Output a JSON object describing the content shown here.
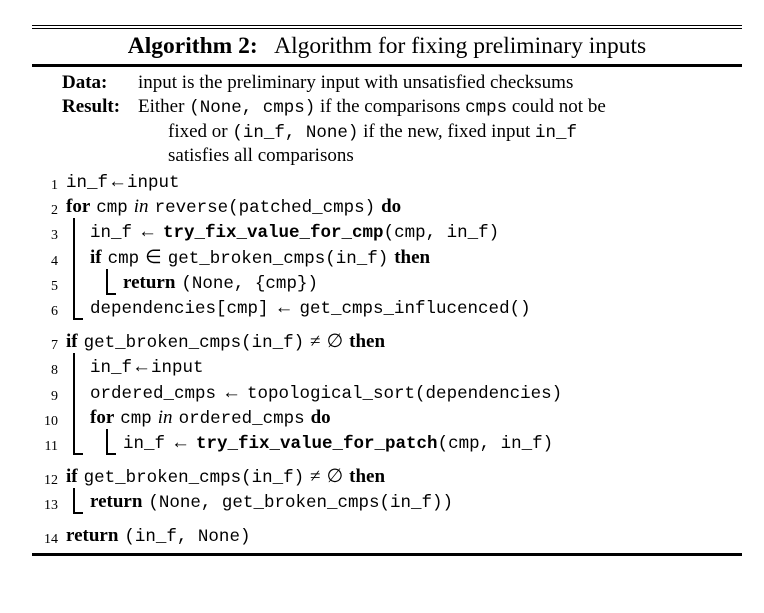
{
  "caption": {
    "label": "Algorithm 2:",
    "text": "Algorithm for fixing preliminary inputs"
  },
  "io": {
    "data_key": "Data:",
    "data_value": "input is the preliminary input with unsatisfied checksums",
    "result_key": "Result:",
    "result_line1_a": "Either ",
    "result_line1_mono1": "(None, cmps)",
    "result_line1_b": " if the comparisons ",
    "result_line1_mono2": "cmps",
    "result_line1_c": " could not be",
    "result_line2_a": "fixed or ",
    "result_line2_mono1": "(in_f, None)",
    "result_line2_b": " if the new, fixed input ",
    "result_line2_mono2": "in_f",
    "result_line3": "satisfies all comparisons"
  },
  "lines": [
    {
      "no": "1",
      "text": "in_f←input",
      "tokens": [
        {
          "t": "in_f",
          "s": "mono"
        },
        {
          "t": "←",
          "s": "sym"
        },
        {
          "t": "input",
          "s": "mono"
        }
      ]
    },
    {
      "no": "2",
      "text": "for cmp in reverse(patched_cmps) do",
      "tokens": [
        {
          "t": "for",
          "s": "kw"
        },
        {
          "t": " ",
          "s": "sp"
        },
        {
          "t": "cmp",
          "s": "mono"
        },
        {
          "t": " ",
          "s": "sp"
        },
        {
          "t": "in",
          "s": "it"
        },
        {
          "t": " ",
          "s": "sp"
        },
        {
          "t": "reverse(patched_cmps)",
          "s": "mono"
        },
        {
          "t": " ",
          "s": "sp"
        },
        {
          "t": "do",
          "s": "kw"
        }
      ]
    },
    {
      "no": "3",
      "text": "in_f ← try_fix_value_for_cmp(cmp, in_f)",
      "tokens": [
        {
          "t": "in_f",
          "s": "mono"
        },
        {
          "t": " ",
          "s": "sp"
        },
        {
          "t": "←",
          "s": "sym"
        },
        {
          "t": " ",
          "s": "sp"
        },
        {
          "t": "try_fix_value_for_cmp",
          "s": "monob"
        },
        {
          "t": "(cmp, in_f)",
          "s": "mono"
        }
      ]
    },
    {
      "no": "4",
      "text": "if cmp ∈ get_broken_cmps(in_f) then",
      "tokens": [
        {
          "t": "if",
          "s": "kw"
        },
        {
          "t": " ",
          "s": "sp"
        },
        {
          "t": "cmp",
          "s": "mono"
        },
        {
          "t": " ",
          "s": "sp"
        },
        {
          "t": "∈",
          "s": "sym"
        },
        {
          "t": " ",
          "s": "sp"
        },
        {
          "t": "get_broken_cmps(in_f)",
          "s": "mono"
        },
        {
          "t": " ",
          "s": "sp"
        },
        {
          "t": "then",
          "s": "kw"
        }
      ]
    },
    {
      "no": "5",
      "text": "return (None, {cmp})",
      "tokens": [
        {
          "t": "return",
          "s": "kw"
        },
        {
          "t": " ",
          "s": "sp"
        },
        {
          "t": "(None, {cmp})",
          "s": "mono"
        }
      ]
    },
    {
      "no": "6",
      "text": "dependencies[cmp] ← get_cmps_influcenced()",
      "tokens": [
        {
          "t": "dependencies[cmp]",
          "s": "mono"
        },
        {
          "t": " ",
          "s": "sp"
        },
        {
          "t": "←",
          "s": "sym"
        },
        {
          "t": " ",
          "s": "sp"
        },
        {
          "t": "get_cmps_influcenced()",
          "s": "mono"
        }
      ]
    },
    {
      "no": "7",
      "text": "if get_broken_cmps(in_f) ≠ ∅ then",
      "tokens": [
        {
          "t": "if",
          "s": "kw"
        },
        {
          "t": " ",
          "s": "sp"
        },
        {
          "t": "get_broken_cmps(in_f)",
          "s": "mono"
        },
        {
          "t": " ",
          "s": "sp"
        },
        {
          "t": "≠",
          "s": "sym"
        },
        {
          "t": " ",
          "s": "sp"
        },
        {
          "t": "∅",
          "s": "sym"
        },
        {
          "t": " ",
          "s": "sp"
        },
        {
          "t": "then",
          "s": "kw"
        }
      ]
    },
    {
      "no": "8",
      "text": "in_f←input",
      "tokens": [
        {
          "t": "in_f",
          "s": "mono"
        },
        {
          "t": "←",
          "s": "sym"
        },
        {
          "t": "input",
          "s": "mono"
        }
      ]
    },
    {
      "no": "9",
      "text": "ordered_cmps ← topological_sort(dependencies)",
      "tokens": [
        {
          "t": "ordered_cmps",
          "s": "mono"
        },
        {
          "t": " ",
          "s": "sp"
        },
        {
          "t": "←",
          "s": "sym"
        },
        {
          "t": " ",
          "s": "sp"
        },
        {
          "t": "topological_sort(dependencies)",
          "s": "mono"
        }
      ]
    },
    {
      "no": "10",
      "text": "for cmp in ordered_cmps do",
      "tokens": [
        {
          "t": "for",
          "s": "kw"
        },
        {
          "t": " ",
          "s": "sp"
        },
        {
          "t": "cmp",
          "s": "mono"
        },
        {
          "t": " ",
          "s": "sp"
        },
        {
          "t": "in",
          "s": "it"
        },
        {
          "t": " ",
          "s": "sp"
        },
        {
          "t": "ordered_cmps",
          "s": "mono"
        },
        {
          "t": " ",
          "s": "sp"
        },
        {
          "t": "do",
          "s": "kw"
        }
      ]
    },
    {
      "no": "11",
      "text": "in_f ← try_fix_value_for_patch(cmp, in_f)",
      "tokens": [
        {
          "t": "in_f",
          "s": "mono"
        },
        {
          "t": " ",
          "s": "sp"
        },
        {
          "t": "←",
          "s": "sym"
        },
        {
          "t": " ",
          "s": "sp"
        },
        {
          "t": "try_fix_value_for_patch",
          "s": "monob"
        },
        {
          "t": "(cmp, in_f)",
          "s": "mono"
        }
      ]
    },
    {
      "no": "12",
      "text": "if get_broken_cmps(in_f) ≠ ∅ then",
      "tokens": [
        {
          "t": "if",
          "s": "kw"
        },
        {
          "t": " ",
          "s": "sp"
        },
        {
          "t": "get_broken_cmps(in_f)",
          "s": "mono"
        },
        {
          "t": " ",
          "s": "sp"
        },
        {
          "t": "≠",
          "s": "sym"
        },
        {
          "t": " ",
          "s": "sp"
        },
        {
          "t": "∅",
          "s": "sym"
        },
        {
          "t": " ",
          "s": "sp"
        },
        {
          "t": "then",
          "s": "kw"
        }
      ]
    },
    {
      "no": "13",
      "text": "return (None, get_broken_cmps(in_f))",
      "tokens": [
        {
          "t": "return",
          "s": "kw"
        },
        {
          "t": " ",
          "s": "sp"
        },
        {
          "t": "(None, get_broken_cmps(in_f))",
          "s": "mono"
        }
      ]
    },
    {
      "no": "14",
      "text": "return (in_f, None)",
      "tokens": [
        {
          "t": "return",
          "s": "kw"
        },
        {
          "t": " ",
          "s": "sp"
        },
        {
          "t": "(in_f, None)",
          "s": "mono"
        }
      ]
    }
  ]
}
